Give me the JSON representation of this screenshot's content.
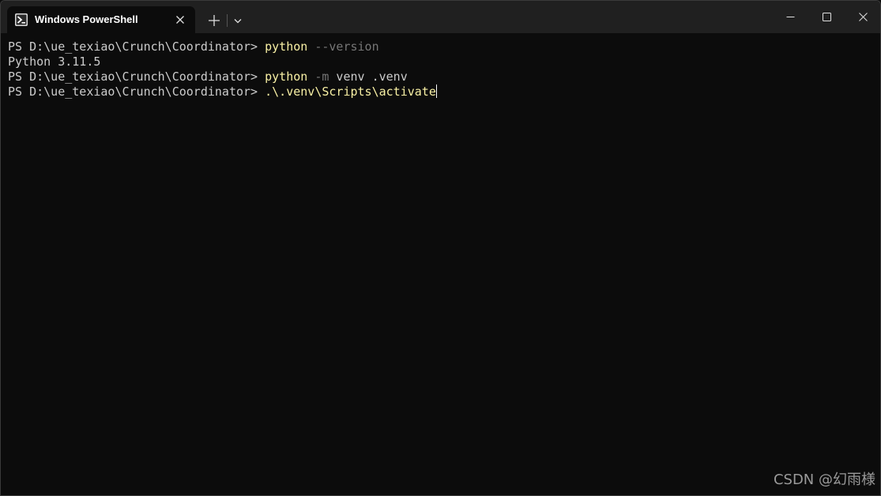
{
  "window": {
    "tab_title": "Windows PowerShell",
    "tab_icon": "powershell-icon",
    "buttons": {
      "new_tab": "plus-icon",
      "dropdown": "chevron-down-icon",
      "minimize": "minimize-icon",
      "maximize": "maximize-icon",
      "close": "close-icon"
    }
  },
  "terminal": {
    "lines": [
      {
        "prompt": "PS D:\\ue_texiao\\Crunch\\Coordinator> ",
        "cmd": "python",
        "param": " --version",
        "arg": ""
      },
      {
        "output": "Python 3.11.5"
      },
      {
        "prompt": "PS D:\\ue_texiao\\Crunch\\Coordinator> ",
        "cmd": "python",
        "param": " -m",
        "arg": " venv .venv"
      },
      {
        "prompt": "PS D:\\ue_texiao\\Crunch\\Coordinator> ",
        "cmd": ".\\.venv\\Scripts\\activate",
        "param": "",
        "arg": ""
      }
    ]
  },
  "colors": {
    "background": "#0c0c0c",
    "titlebar": "#202020",
    "text": "#cccccc",
    "command": "#f9f1a5",
    "parameter": "#767676"
  },
  "watermark": "CSDN @幻雨様"
}
